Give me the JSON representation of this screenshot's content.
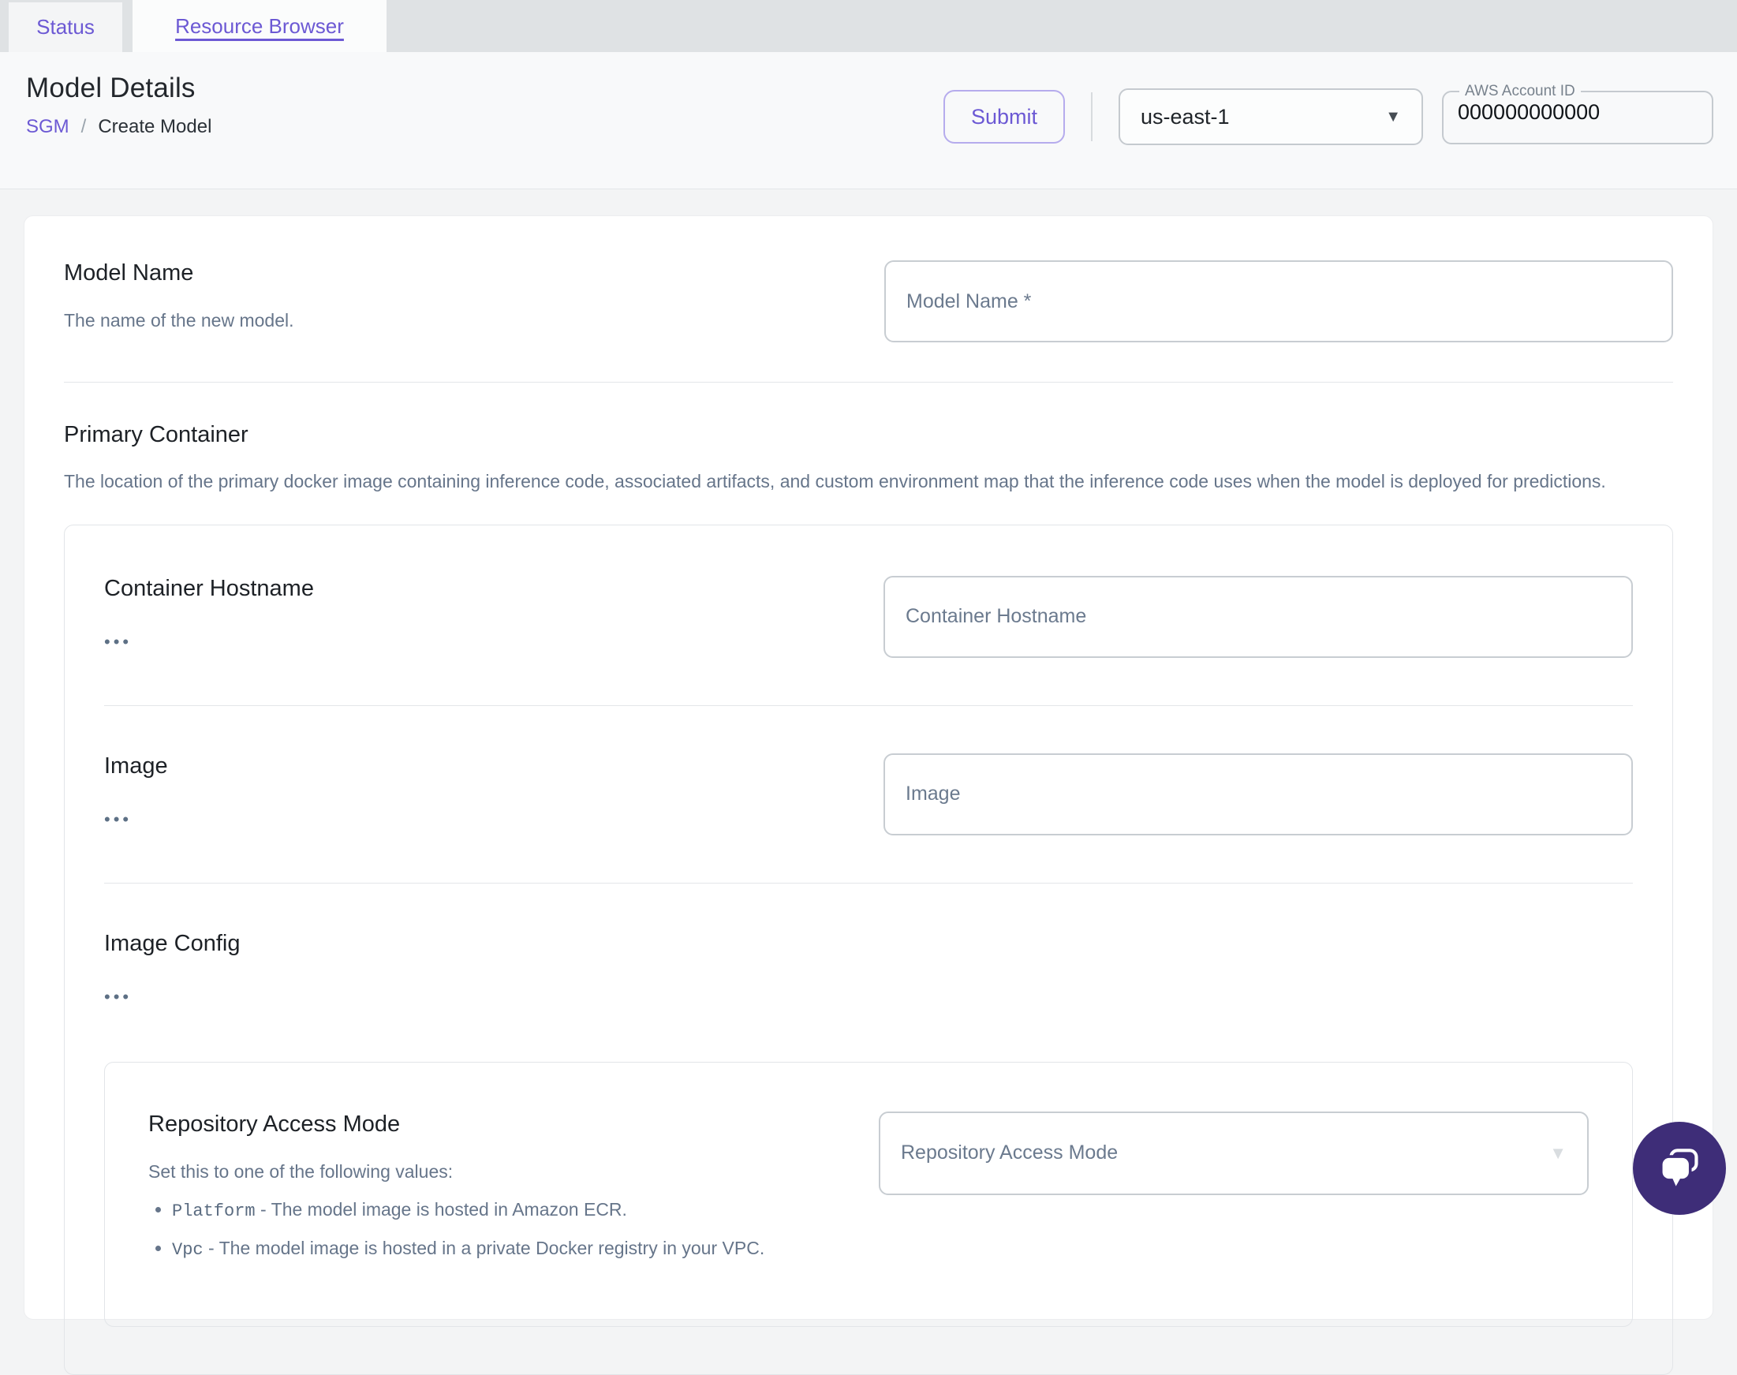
{
  "tabs": [
    {
      "label": "Status",
      "active": false
    },
    {
      "label": "Resource Browser",
      "active": true
    }
  ],
  "header": {
    "title": "Model Details",
    "breadcrumb": {
      "parent": "SGM",
      "separator": "/",
      "current": "Create Model"
    },
    "submit_label": "Submit",
    "region": {
      "value": "us-east-1"
    },
    "account": {
      "label": "AWS Account ID",
      "value": "000000000000"
    }
  },
  "icons": {
    "caret_down": "▼",
    "expander_dots": "•••"
  },
  "form": {
    "model_name": {
      "label": "Model Name",
      "description": "The name of the new model.",
      "placeholder": "Model Name *"
    },
    "primary_container": {
      "label": "Primary Container",
      "description": "The location of the primary docker image containing inference code, associated artifacts, and custom environment map that the inference code uses when the model is deployed for predictions.",
      "container_hostname": {
        "label": "Container Hostname",
        "placeholder": "Container Hostname"
      },
      "image": {
        "label": "Image",
        "placeholder": "Image"
      },
      "image_config": {
        "label": "Image Config",
        "repository_access_mode": {
          "label": "Repository Access Mode",
          "description": "Set this to one of the following values:",
          "options_info": [
            {
              "code": "Platform",
              "text": "- The model image is hosted in Amazon ECR."
            },
            {
              "code": "Vpc",
              "text": "- The model image is hosted in a private Docker registry in your VPC."
            }
          ],
          "placeholder": "Repository Access Mode"
        }
      }
    }
  },
  "colors": {
    "accent": "#6c59d4",
    "accent-border": "#b6aced",
    "chat": "#3e2d78",
    "text": "#1d2126",
    "muted": "#66758a",
    "input-border": "#c8cdd2"
  }
}
